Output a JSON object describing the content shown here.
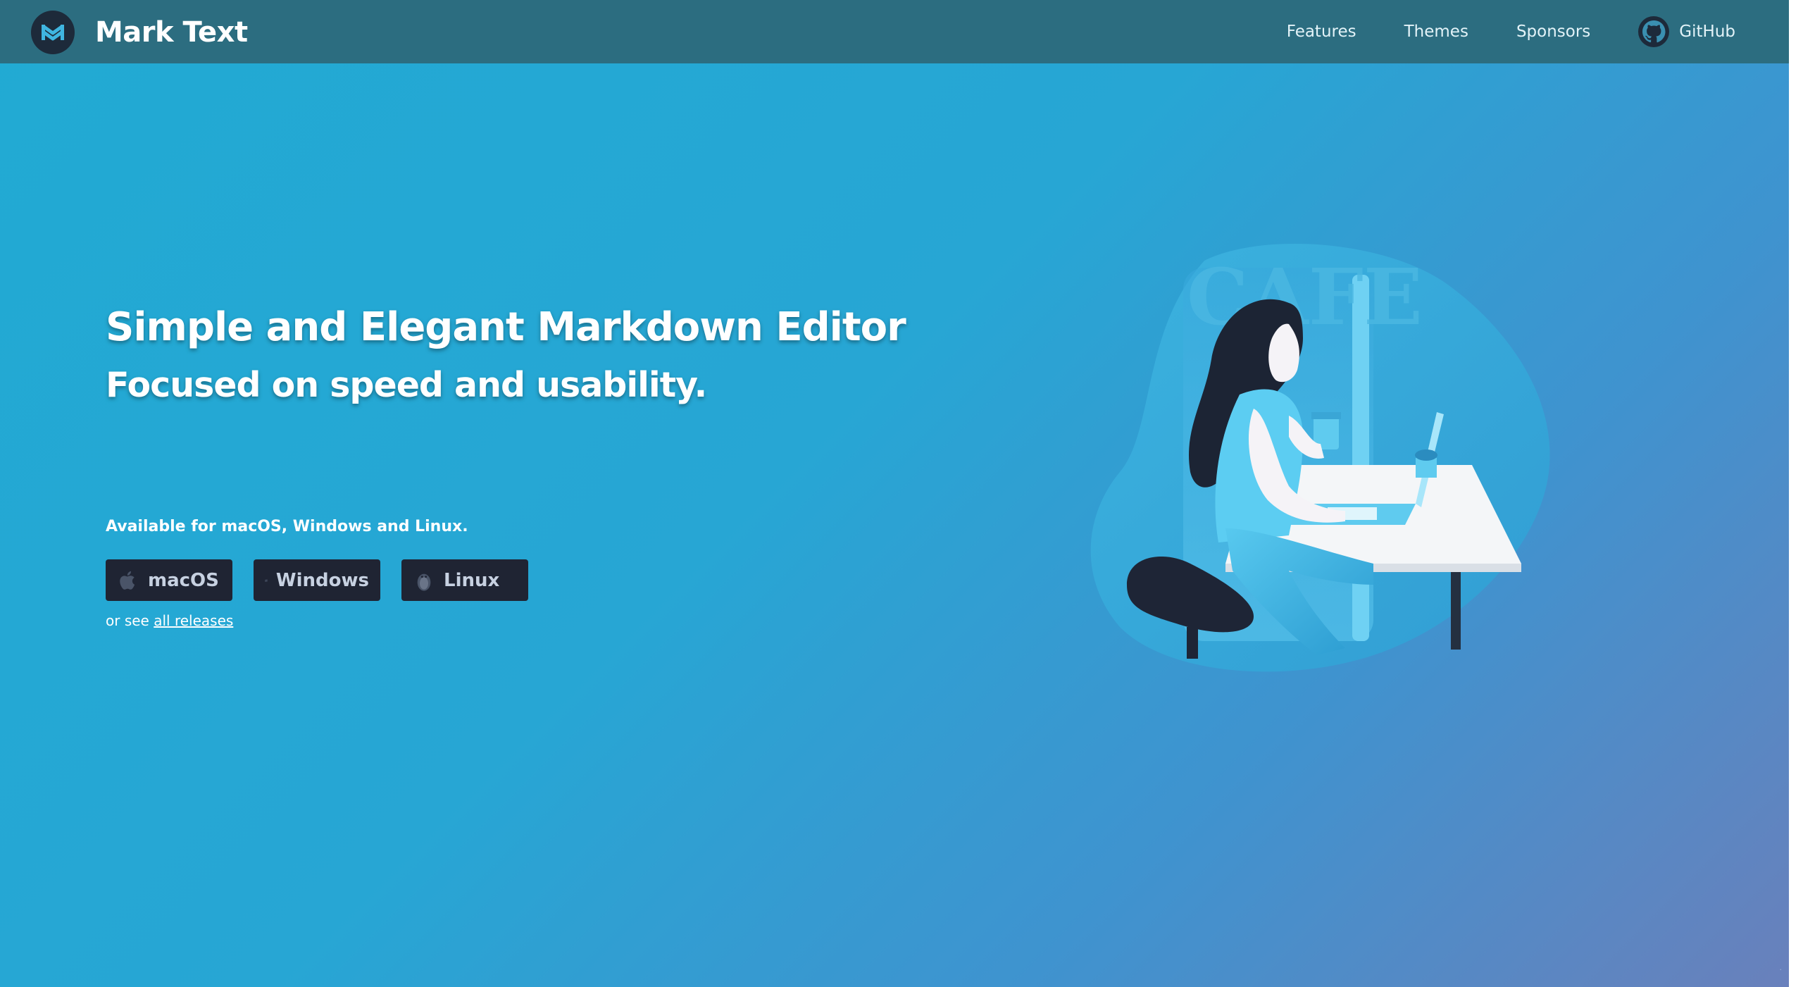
{
  "colors": {
    "navbar": "#2c6d80",
    "button_bg": "#1f2433",
    "hero_gradient_start": "#21aad3",
    "hero_gradient_end": "#6a80bb"
  },
  "nav": {
    "brand": "Mark Text",
    "brand_icon": "marktext-logo-icon",
    "links": [
      {
        "label": "Features"
      },
      {
        "label": "Themes"
      },
      {
        "label": "Sponsors"
      },
      {
        "label": "GitHub",
        "icon": "github-icon"
      }
    ]
  },
  "hero": {
    "title": "Simple and Elegant Markdown Editor",
    "subtitle": "Focused on speed and usability.",
    "availability": "Available for macOS, Windows and Linux.",
    "buttons": [
      {
        "label": "macOS",
        "icon": "apple-icon"
      },
      {
        "label": "Windows",
        "icon": "windows-icon"
      },
      {
        "label": "Linux",
        "icon": "linux-icon"
      }
    ],
    "releases_prefix": "or see",
    "releases_link": "all releases"
  },
  "illustration": {
    "sign_text": "CAFE",
    "icon": "woman-at-laptop-illustration"
  }
}
